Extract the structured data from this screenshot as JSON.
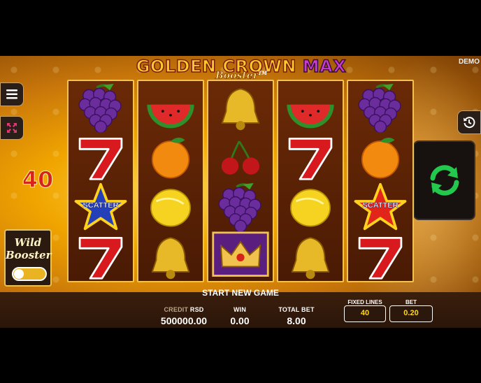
{
  "header": {
    "title_part1": "GOLDEN CROWN",
    "title_part2": "MAX",
    "subtitle": "Booster",
    "trademark": "TM",
    "mode_badge": "DEMO"
  },
  "left_panel": {
    "lines_count": "40",
    "wild_booster_label_line1": "Wild",
    "wild_booster_label_line2": "Booster",
    "wild_booster_enabled": false
  },
  "icons": {
    "menu": "menu-icon",
    "fullscreen": "fullscreen-icon",
    "history": "history-icon",
    "spin": "spin-icon"
  },
  "reels": [
    [
      "grapes",
      "seven",
      "scatter",
      "seven"
    ],
    [
      "watermelon",
      "orange",
      "lemon",
      "bell"
    ],
    [
      "bell",
      "cherry",
      "grapes",
      "crown"
    ],
    [
      "watermelon",
      "seven",
      "lemon",
      "bell"
    ],
    [
      "grapes",
      "orange",
      "scatter",
      "seven"
    ]
  ],
  "scatter_label": "SCATTER",
  "status": {
    "message": "START NEW GAME"
  },
  "stats": {
    "credit_label": "CREDIT",
    "currency": "RSD",
    "credit_value": "500000.00",
    "win_label": "WIN",
    "win_value": "0.00",
    "total_bet_label": "TOTAL BET",
    "total_bet_value": "8.00"
  },
  "controls": {
    "fixed_lines_label": "FIXED LINES",
    "fixed_lines_value": "40",
    "bet_label": "BET",
    "bet_value": "0.20"
  },
  "colors": {
    "accent_gold": "#f2c24e",
    "value_yellow": "#ffd81d",
    "spin_green": "#22c94c",
    "lines_red": "#d8231c"
  }
}
